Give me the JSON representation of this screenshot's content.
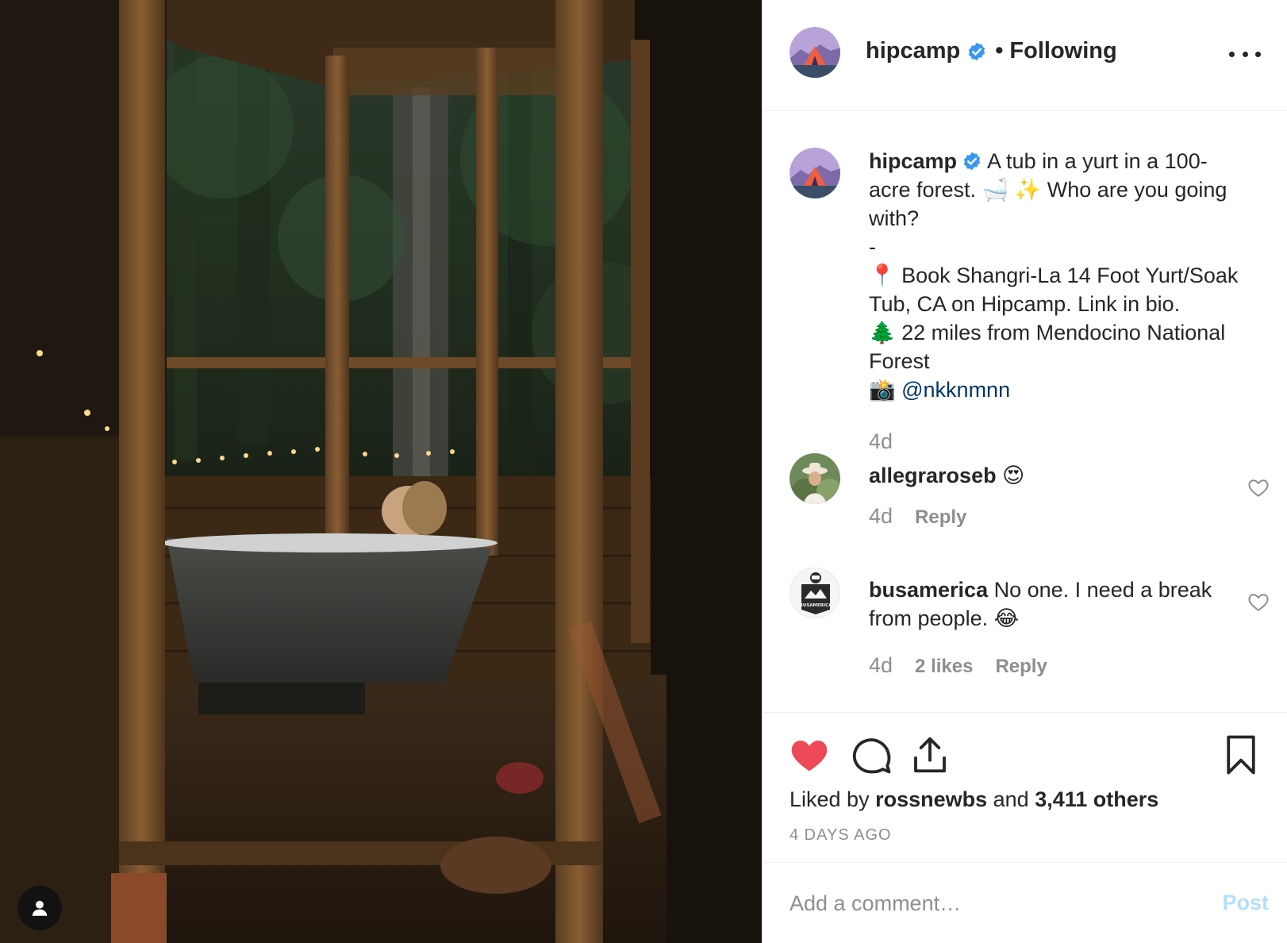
{
  "post": {
    "author": "hipcamp",
    "follow_status": "Following",
    "dot_separator": "•",
    "photo_alt": "A tub in a yurt in a 100-acre forest."
  },
  "caption": {
    "username": "hipcamp",
    "line1": "A tub in a yurt in a 100-",
    "line2": "acre forest. 🛁 ✨  Who are you going",
    "line3": "with?",
    "line4": "-",
    "line5": "📍 Book Shangri-La 14 Foot Yurt/Soak",
    "line6": "Tub, CA on Hipcamp. Link in bio.",
    "line7": "🌲 22 miles from Mendocino National",
    "line8": "Forest",
    "line9_prefix": "📸 ",
    "mention": "@nkknmnn",
    "time": "4d"
  },
  "comments": [
    {
      "username": "allegraroseb",
      "text": " 😍",
      "time": "4d",
      "reply": "Reply"
    },
    {
      "username": "busamerica",
      "text_line1": " No one. I need a break",
      "text_line2": "from people. 😂",
      "time": "4d",
      "likes": "2 likes",
      "reply": "Reply",
      "avatar_text": "BUSAMERICA"
    }
  ],
  "actions": {
    "liked_prefix": "Liked by ",
    "liked_user": "rossnewbs",
    "liked_and": " and ",
    "liked_count": "3,411 others",
    "date": "4 DAYS AGO"
  },
  "add_comment": {
    "placeholder": "Add a comment…",
    "post_label": "Post"
  },
  "colors": {
    "like_red": "#ed4956",
    "verified_blue": "#3897f0",
    "muted": "#8e8e8e",
    "post_disabled": "#b2dffc"
  }
}
